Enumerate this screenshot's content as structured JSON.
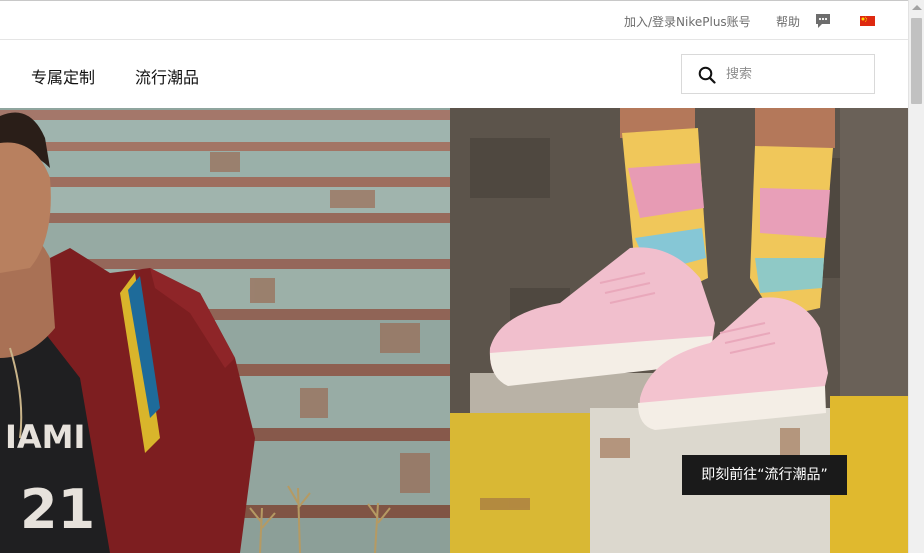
{
  "utility_bar": {
    "login_label": "加入/登录NikePlus账号",
    "help_label": "帮助",
    "chat_icon": "chat-bubble-icon",
    "region_icon": "china-flag-icon"
  },
  "nav": {
    "items": [
      {
        "label": "专属定制"
      },
      {
        "label": "流行潮品"
      }
    ],
    "search": {
      "placeholder": "搜索",
      "value": "",
      "icon": "search-icon"
    }
  },
  "hero": {
    "left_image": "athlete-in-red-jacket-on-stairs",
    "right_image": "pink-sneakers-tie-dye-socks-on-ledge",
    "cta_label": "即刻前往“流行潮品”"
  },
  "colors": {
    "cta_background": "#1a1a1a",
    "flag_red": "#de2910",
    "flag_yellow": "#ffde00"
  }
}
